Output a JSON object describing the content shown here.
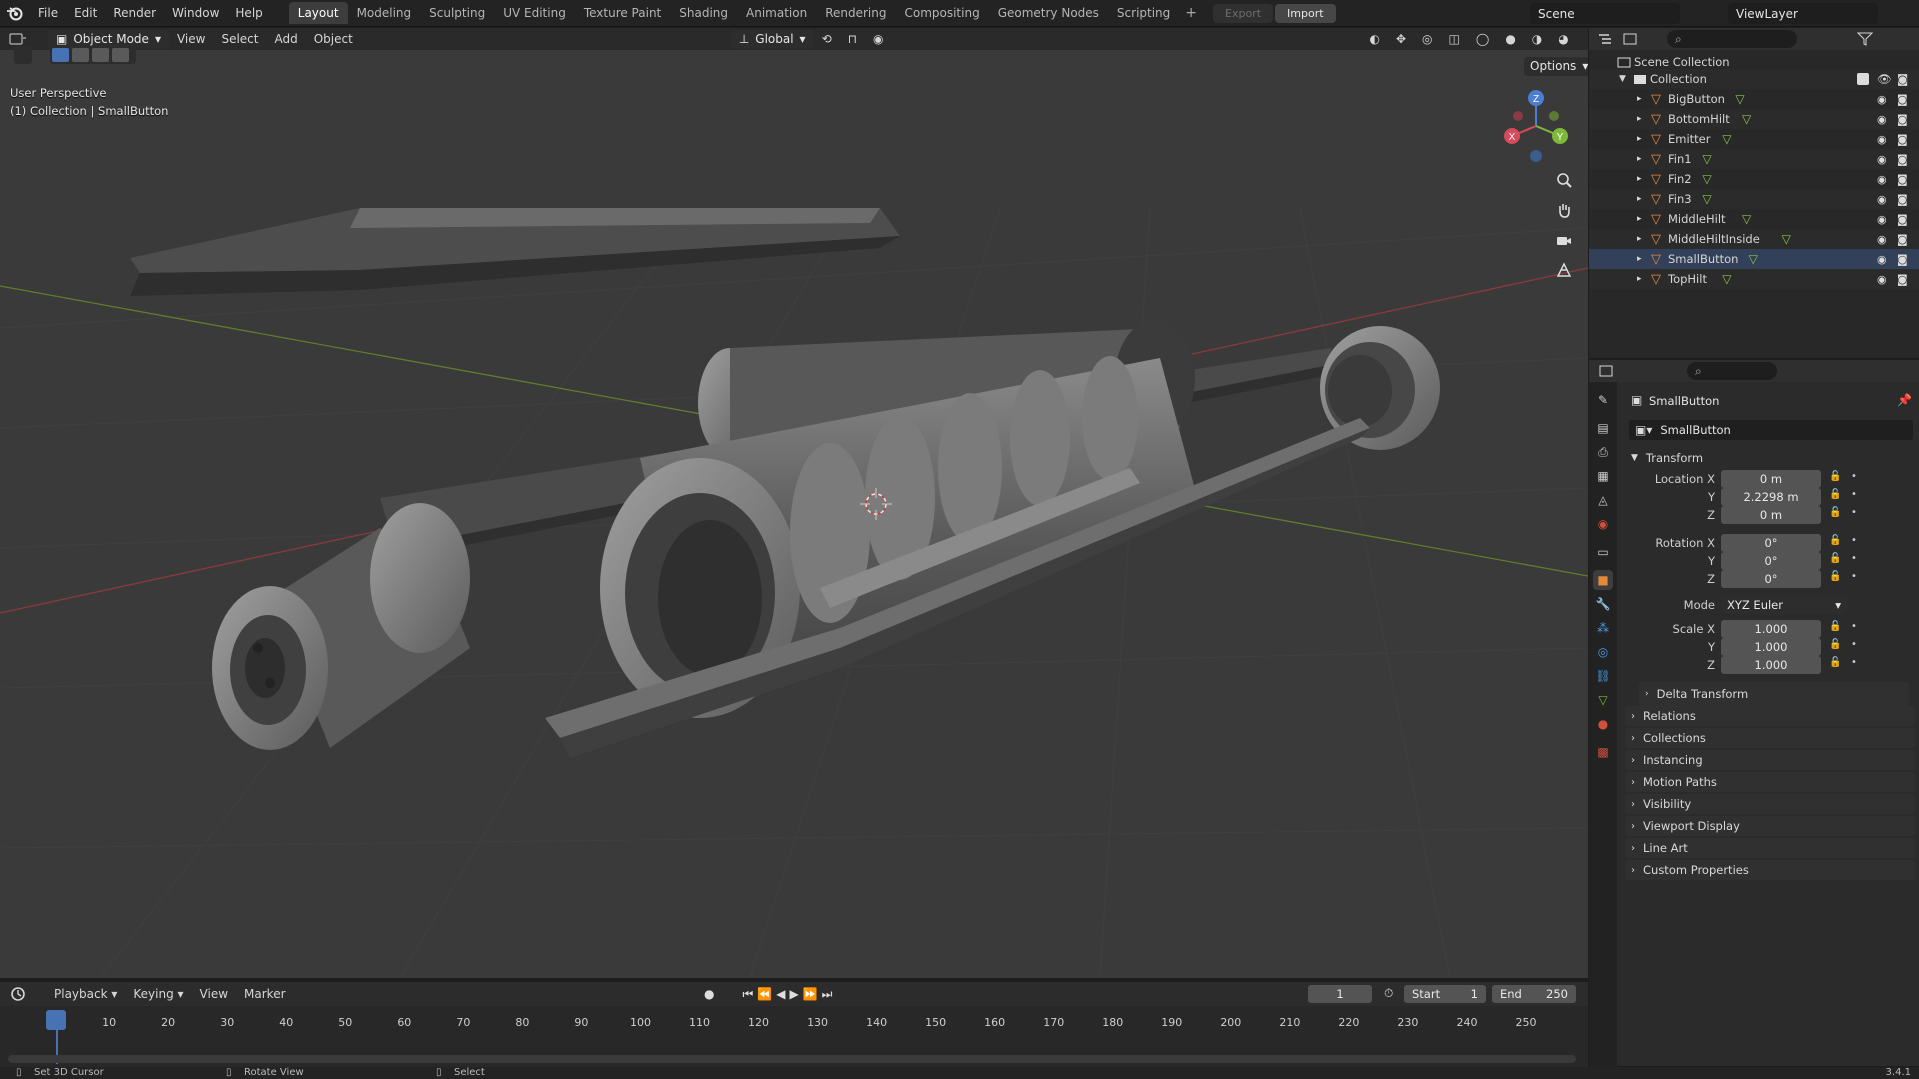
{
  "app": {
    "version": "3.4.1"
  },
  "menu": [
    "File",
    "Edit",
    "Render",
    "Window",
    "Help"
  ],
  "workspaces": [
    {
      "label": "Layout",
      "active": true
    },
    {
      "label": "Modeling"
    },
    {
      "label": "Sculpting"
    },
    {
      "label": "UV Editing"
    },
    {
      "label": "Texture Paint"
    },
    {
      "label": "Shading"
    },
    {
      "label": "Animation"
    },
    {
      "label": "Rendering"
    },
    {
      "label": "Compositing"
    },
    {
      "label": "Geometry Nodes"
    },
    {
      "label": "Scripting"
    }
  ],
  "topbar": {
    "export_label": "Export",
    "import_label": "Import",
    "scene": "Scene",
    "view_layer": "ViewLayer"
  },
  "viewport": {
    "mode": "Object Mode",
    "menus": [
      "View",
      "Select",
      "Add",
      "Object"
    ],
    "orientation": "Global",
    "options_label": "Options",
    "perspective": "User Perspective",
    "context": "(1) Collection | SmallButton",
    "axes": {
      "x": "X",
      "y": "Y",
      "z": "Z"
    }
  },
  "outliner": {
    "root": "Scene Collection",
    "collection": "Collection",
    "objects": [
      "BigButton",
      "BottomHilt",
      "Emitter",
      "Fin1",
      "Fin2",
      "Fin3",
      "MiddleHilt",
      "MiddleHiltInside",
      "SmallButton",
      "TopHilt"
    ],
    "selected": "SmallButton"
  },
  "properties": {
    "object_name": "SmallButton",
    "datablock": "SmallButton",
    "transform_label": "Transform",
    "location_x_label": "Location X",
    "location_x": "0 m",
    "location_y_label": "Y",
    "location_y": "2.2298 m",
    "location_z_label": "Z",
    "location_z": "0 m",
    "rotation_x_label": "Rotation X",
    "rotation_x": "0°",
    "rotation_y_label": "Y",
    "rotation_y": "0°",
    "rotation_z_label": "Z",
    "rotation_z": "0°",
    "mode_label": "Mode",
    "mode": "XYZ Euler",
    "scale_x_label": "Scale X",
    "scale_x": "1.000",
    "scale_y_label": "Y",
    "scale_y": "1.000",
    "scale_z_label": "Z",
    "scale_z": "1.000",
    "delta_transform": "Delta Transform",
    "sections": [
      "Relations",
      "Collections",
      "Instancing",
      "Motion Paths",
      "Visibility",
      "Viewport Display",
      "Line Art",
      "Custom Properties"
    ]
  },
  "timeline": {
    "menus": [
      "Playback",
      "Keying",
      "View",
      "Marker"
    ],
    "current_frame": "1",
    "start_label": "Start",
    "start": "1",
    "end_label": "End",
    "end": "250",
    "ticks": [
      "1",
      "10",
      "20",
      "30",
      "40",
      "50",
      "60",
      "70",
      "80",
      "90",
      "100",
      "110",
      "120",
      "130",
      "140",
      "150",
      "160",
      "170",
      "180",
      "190",
      "200",
      "210",
      "220",
      "230",
      "240",
      "250"
    ]
  },
  "statusbar": {
    "left": "Set 3D Cursor",
    "middle": "Rotate View",
    "right": "Select"
  },
  "colors": {
    "accent": "#4772b3",
    "selected_orange": "#e28a3a",
    "mesh_green": "#8bc34a"
  }
}
